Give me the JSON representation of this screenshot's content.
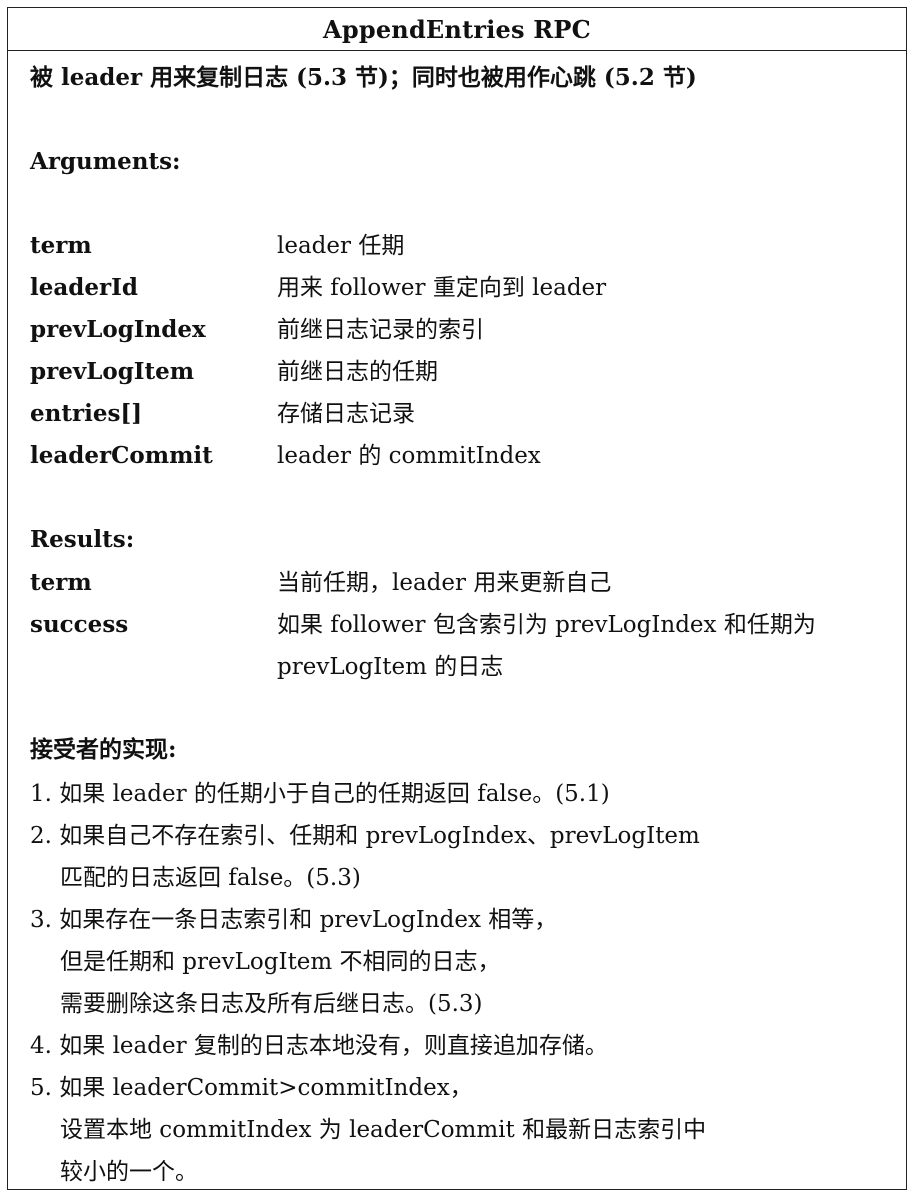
{
  "title": "AppendEntries RPC",
  "description": "被 leader 用来复制日志 (5.3 节)；同时也被用作心跳 (5.2 节)",
  "arguments_heading": "Arguments:",
  "arguments": [
    {
      "name": "term",
      "desc": "leader 任期"
    },
    {
      "name": "leaderId",
      "desc": "用来 follower 重定向到 leader"
    },
    {
      "name": "prevLogIndex",
      "desc": "前继日志记录的索引"
    },
    {
      "name": "prevLogItem",
      "desc": "前继日志的任期"
    },
    {
      "name": "entries[]",
      "desc": "存储日志记录"
    },
    {
      "name": "leaderCommit",
      "desc": "leader 的 commitIndex"
    }
  ],
  "results_heading": "Results:",
  "results": [
    {
      "name": "term",
      "desc": "当前任期，leader 用来更新自己"
    },
    {
      "name": "success",
      "desc": "如果 follower 包含索引为 prevLogIndex 和任期为 prevLogItem 的日志"
    }
  ],
  "receiver_heading": "接受者的实现:",
  "receiver_steps": [
    {
      "lines": [
        "1. 如果 leader 的任期小于自己的任期返回 false。(5.1)"
      ]
    },
    {
      "lines": [
        "2. 如果自己不存在索引、任期和 prevLogIndex、prevLogItem",
        "匹配的日志返回 false。(5.3)"
      ]
    },
    {
      "lines": [
        "3. 如果存在一条日志索引和 prevLogIndex 相等，",
        "但是任期和 prevLogItem 不相同的日志，",
        "需要删除这条日志及所有后继日志。(5.3)"
      ]
    },
    {
      "lines": [
        "4. 如果 leader 复制的日志本地没有，则直接追加存储。"
      ]
    },
    {
      "lines": [
        "5. 如果 leaderCommit>commitIndex，",
        "设置本地 commitIndex 为 leaderCommit 和最新日志索引中",
        "较小的一个。"
      ]
    }
  ]
}
